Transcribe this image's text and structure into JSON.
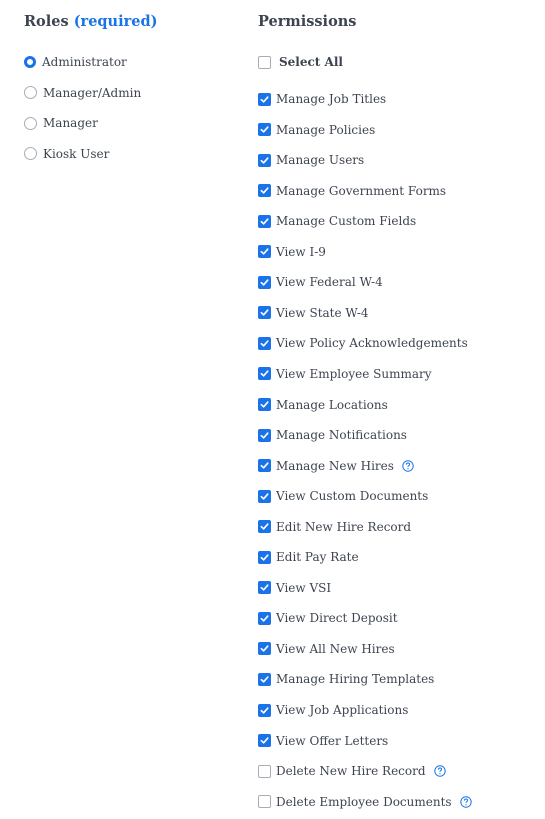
{
  "roles": {
    "heading": "Roles",
    "required": "(required)",
    "options": [
      {
        "label": "Administrator",
        "selected": true
      },
      {
        "label": "Manager/Admin",
        "selected": false
      },
      {
        "label": "Manager",
        "selected": false
      },
      {
        "label": "Kiosk User",
        "selected": false
      }
    ]
  },
  "permissions": {
    "heading": "Permissions",
    "select_all": "Select All",
    "items": [
      {
        "label": "Manage Job Titles",
        "checked": true,
        "help": false
      },
      {
        "label": "Manage Policies",
        "checked": true,
        "help": false
      },
      {
        "label": "Manage Users",
        "checked": true,
        "help": false
      },
      {
        "label": "Manage Government Forms",
        "checked": true,
        "help": false
      },
      {
        "label": "Manage Custom Fields",
        "checked": true,
        "help": false
      },
      {
        "label": "View I-9",
        "checked": true,
        "help": false
      },
      {
        "label": "View Federal W-4",
        "checked": true,
        "help": false
      },
      {
        "label": "View State W-4",
        "checked": true,
        "help": false
      },
      {
        "label": "View Policy Acknowledgements",
        "checked": true,
        "help": false
      },
      {
        "label": "View Employee Summary",
        "checked": true,
        "help": false
      },
      {
        "label": "Manage Locations",
        "checked": true,
        "help": false
      },
      {
        "label": "Manage Notifications",
        "checked": true,
        "help": false
      },
      {
        "label": "Manage New Hires",
        "checked": true,
        "help": true
      },
      {
        "label": "View Custom Documents",
        "checked": true,
        "help": false
      },
      {
        "label": "Edit New Hire Record",
        "checked": true,
        "help": false
      },
      {
        "label": "Edit Pay Rate",
        "checked": true,
        "help": false
      },
      {
        "label": "View VSI",
        "checked": true,
        "help": false
      },
      {
        "label": "View Direct Deposit",
        "checked": true,
        "help": false
      },
      {
        "label": "View All New Hires",
        "checked": true,
        "help": false
      },
      {
        "label": "Manage Hiring Templates",
        "checked": true,
        "help": false
      },
      {
        "label": "View Job Applications",
        "checked": true,
        "help": false
      },
      {
        "label": "View Offer Letters",
        "checked": true,
        "help": false
      },
      {
        "label": "Delete New Hire Record",
        "checked": false,
        "help": true
      },
      {
        "label": "Delete Employee Documents",
        "checked": false,
        "help": true
      }
    ]
  },
  "colors": {
    "accent": "#1a73e8",
    "text": "#3d4450",
    "border": "#a8adb5"
  }
}
